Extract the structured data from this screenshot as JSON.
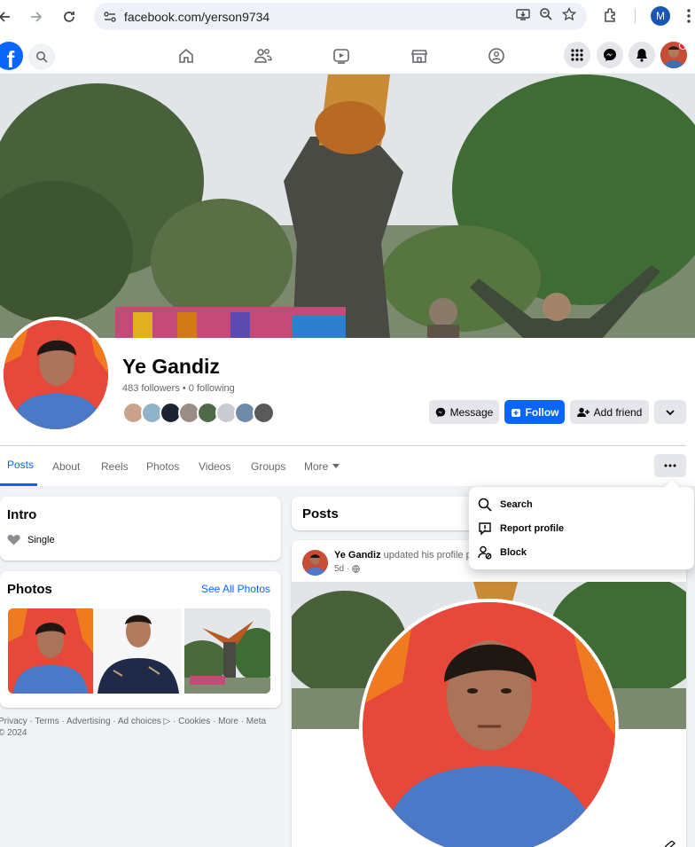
{
  "browser": {
    "url": "facebook.com/yerson9734",
    "profile_initial": "M"
  },
  "fb_nav": {
    "logo": "f",
    "icons": [
      "home-icon",
      "friends-icon",
      "video-icon",
      "marketplace-icon",
      "groups-icon",
      "menu-grid-icon",
      "messenger-icon",
      "notifications-icon"
    ]
  },
  "profile": {
    "name": "Ye Gandiz",
    "stats": "483 followers • 0 following",
    "buttons": {
      "message": "Message",
      "follow": "Follow",
      "add_friend": "Add friend"
    }
  },
  "tabs": [
    "Posts",
    "About",
    "Reels",
    "Photos",
    "Videos",
    "Groups",
    "More"
  ],
  "more_menu": {
    "items": [
      "Search",
      "Report profile",
      "Block"
    ]
  },
  "intro": {
    "title": "Intro",
    "relationship": "Single"
  },
  "photos": {
    "title": "Photos",
    "see_all": "See All Photos"
  },
  "footer": "Privacy · Terms · Advertising · Ad choices ▷ · Cookies · More · Meta © 2024",
  "posts": {
    "title": "Posts",
    "post": {
      "author": "Ye Gandiz",
      "action": "updated his profile p",
      "time": "5d"
    }
  },
  "colors": {
    "fb_blue": "#0866ff",
    "page_bg": "#f0f2f5",
    "button_grey": "#e4e6eb"
  }
}
